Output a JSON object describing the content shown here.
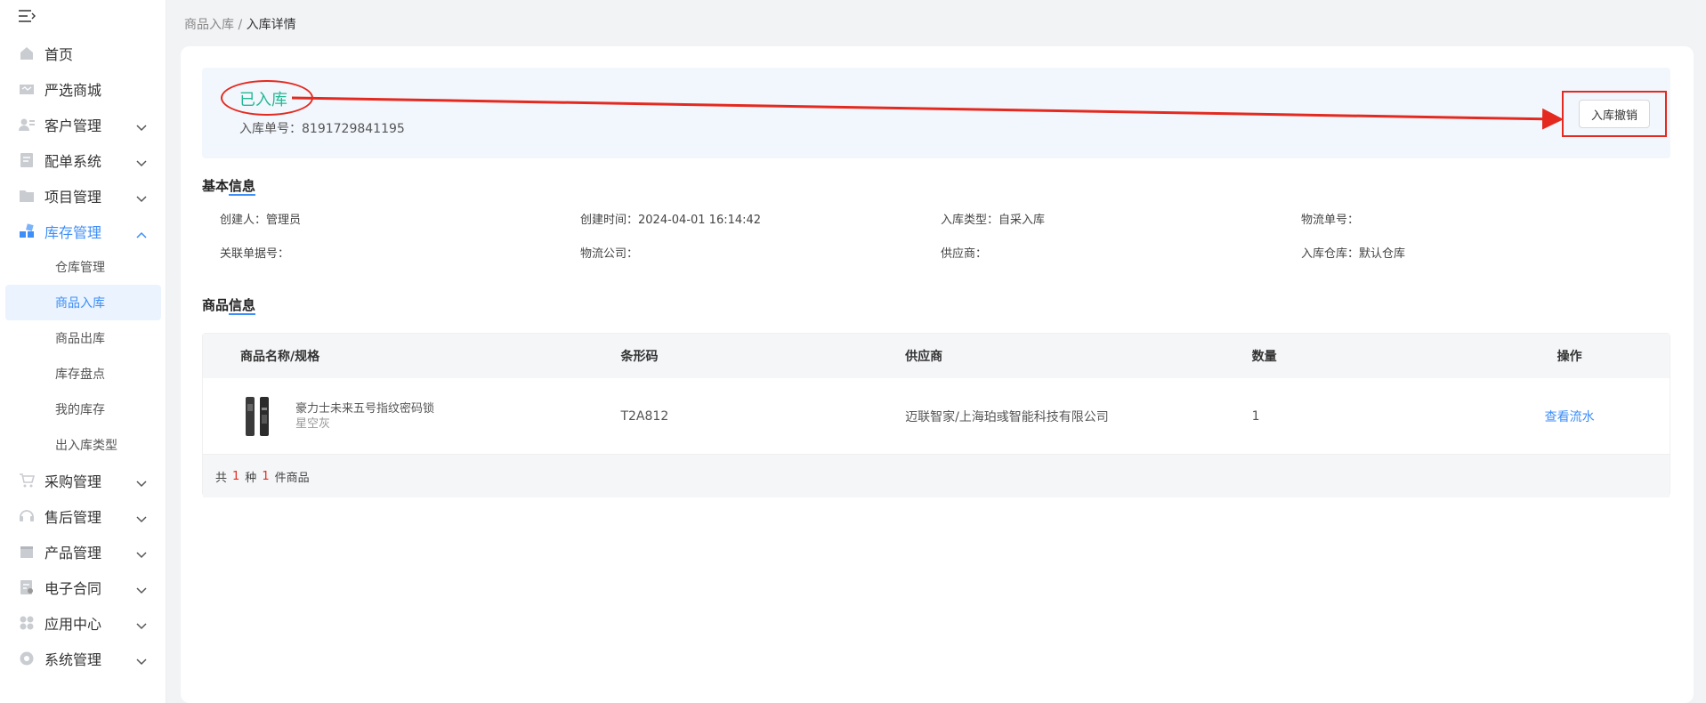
{
  "sidebar": {
    "toggle_icon": "menu-fold-icon",
    "items": [
      {
        "label": "首页",
        "icon": "home-icon"
      },
      {
        "label": "严选商城",
        "icon": "mall-icon"
      },
      {
        "label": "客户管理",
        "icon": "customer-icon"
      },
      {
        "label": "配单系统",
        "icon": "order-icon"
      },
      {
        "label": "项目管理",
        "icon": "folder-icon"
      },
      {
        "label": "库存管理",
        "icon": "inventory-icon"
      },
      {
        "label": "采购管理",
        "icon": "cart-icon"
      },
      {
        "label": "售后管理",
        "icon": "headset-icon"
      },
      {
        "label": "产品管理",
        "icon": "box-icon"
      },
      {
        "label": "电子合同",
        "icon": "contract-icon"
      },
      {
        "label": "应用中心",
        "icon": "apps-icon"
      },
      {
        "label": "系统管理",
        "icon": "settings-icon"
      }
    ],
    "inventory_sub": [
      "仓库管理",
      "商品入库",
      "商品出库",
      "库存盘点",
      "我的库存",
      "出入库类型"
    ]
  },
  "breadcrumb": {
    "parent": "商品入库",
    "sep": "/",
    "current": "入库详情"
  },
  "status": {
    "text": "已入库",
    "order_no_label": "入库单号：",
    "order_no": "8191729841195",
    "revoke_label": "入库撤销"
  },
  "basic_info": {
    "title_a": "基本",
    "title_b": "信息",
    "row1": [
      "创建人：管理员",
      "创建时间：2024-04-01 16:14:42",
      "入库类型：自采入库",
      "物流单号："
    ],
    "row2": [
      "关联单据号：",
      "物流公司：",
      "供应商：",
      "入库仓库：默认仓库"
    ]
  },
  "goods_info": {
    "title_a": "商品",
    "title_b": "信息",
    "headers": [
      "商品名称/规格",
      "条形码",
      "供应商",
      "数量",
      "操作"
    ],
    "rows": [
      {
        "name": "豪力士未来五号指纹密码锁",
        "spec": "星空灰",
        "barcode": "T2A812",
        "supplier": "迈联智家/上海珀彧智能科技有限公司",
        "qty": "1",
        "action": "查看流水"
      }
    ],
    "footer": {
      "prefix": "共",
      "kinds": "1",
      "mid": "种",
      "count": "1",
      "suffix": "件商品"
    }
  },
  "colors": {
    "accent": "#3d8ef7",
    "success": "#24b894",
    "annotation": "#e42a20"
  }
}
